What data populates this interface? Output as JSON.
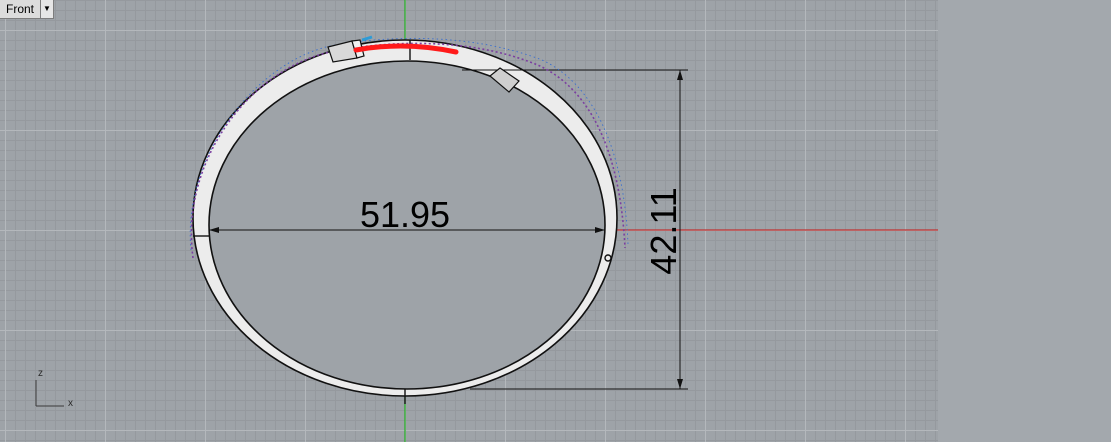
{
  "viewport": {
    "name": "Front",
    "dropdown_icon": "triangle-down-icon"
  },
  "dimensions": {
    "width": "51.95",
    "height": "42.11"
  },
  "axes": {
    "vertical": "z",
    "horizontal": "x"
  },
  "colors": {
    "grid_bg": "#9ea3a8",
    "y_axis": "#22b022",
    "x_axis": "#c03030",
    "selection": "#ff1a1a",
    "curve_dots": "#7b3fa0"
  }
}
